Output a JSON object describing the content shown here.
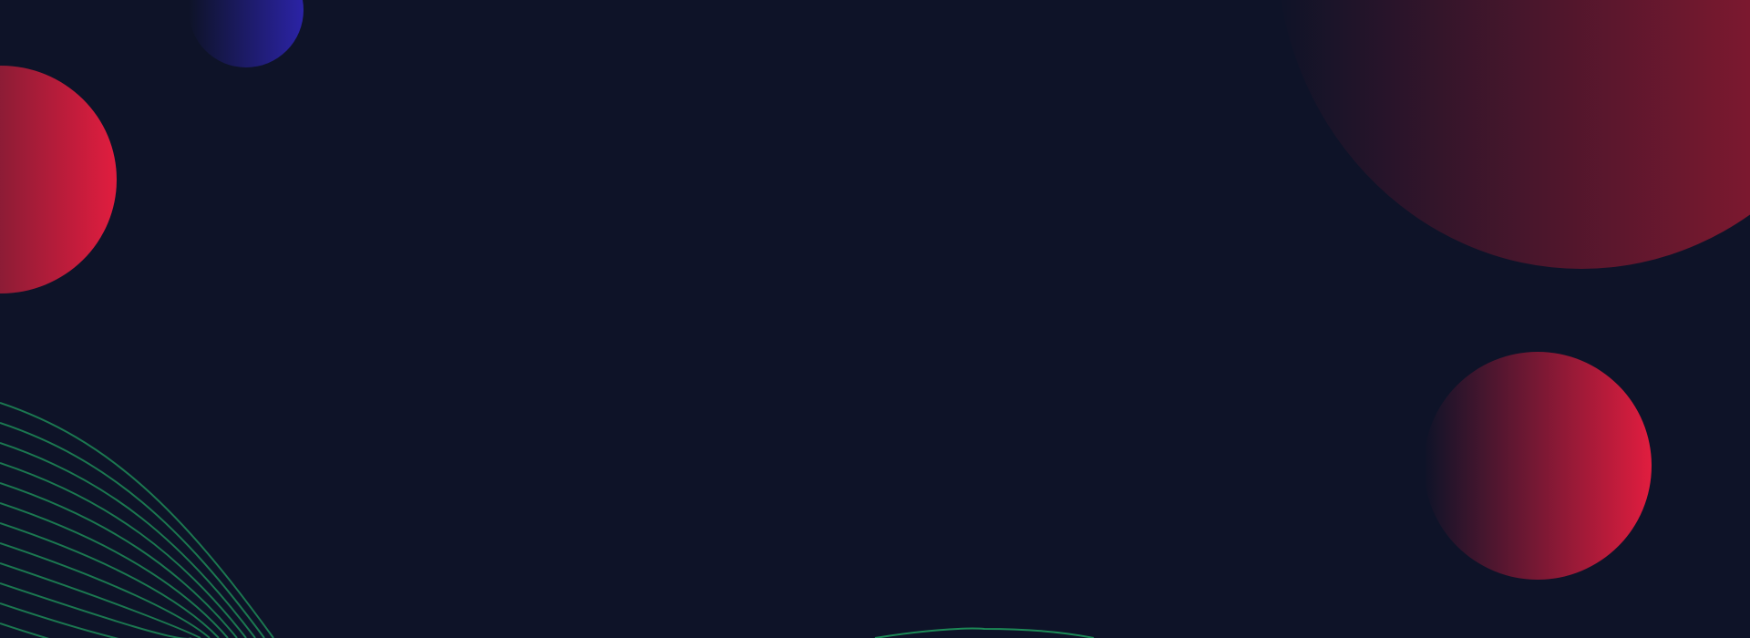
{
  "colors": {
    "background": "#0e1328",
    "red_accent": "#e11d3f",
    "blue_accent": "#2b23a6",
    "wave_green": "#1d8a57"
  },
  "shapes": [
    {
      "name": "small-blue-circle",
      "gradient": [
        "#0e1328",
        "#2b23a6"
      ]
    },
    {
      "name": "left-red-circle",
      "gradient": [
        "#3a1a2c",
        "#e11d3f"
      ]
    },
    {
      "name": "large-top-right-circle",
      "gradient": [
        "#0e1328",
        "#9b1a31"
      ]
    },
    {
      "name": "mid-right-red-circle",
      "gradient": [
        "#0e1328",
        "#e11d3f"
      ]
    }
  ],
  "decor": {
    "wave_lines": "green-wave-lines",
    "bottom_arc": "green-bottom-arc"
  }
}
